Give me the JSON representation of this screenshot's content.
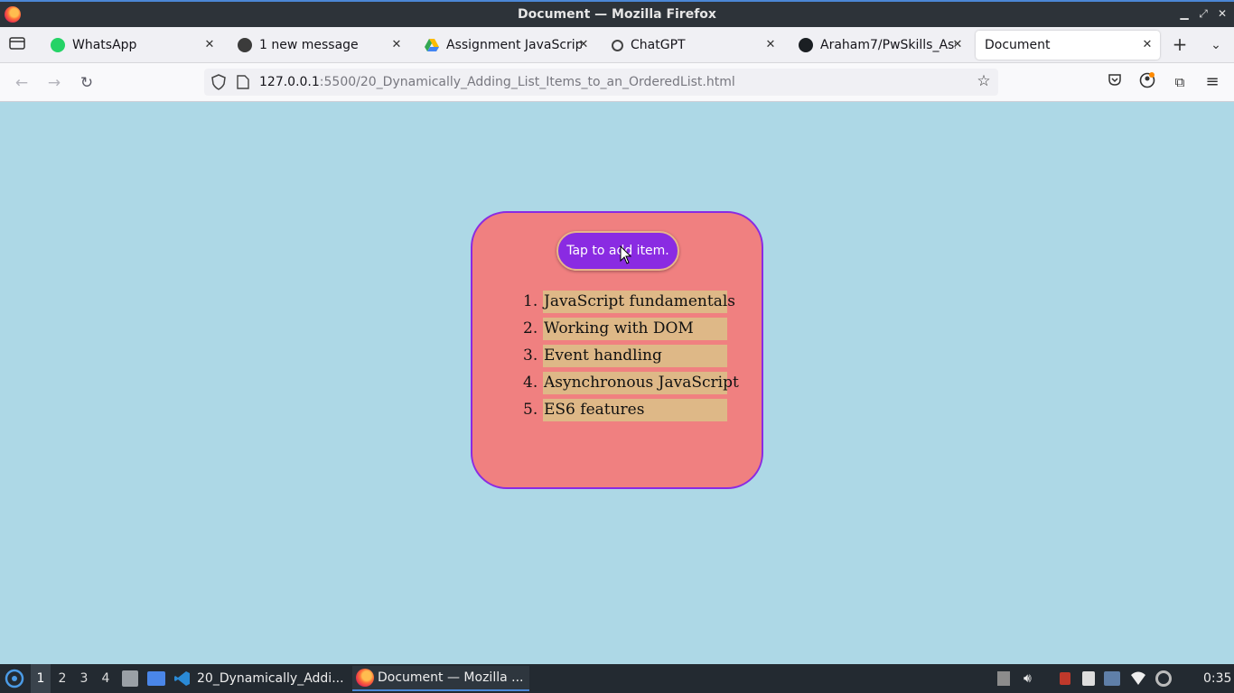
{
  "window": {
    "title": "Document — Mozilla Firefox"
  },
  "tabs": [
    {
      "label": "WhatsApp",
      "icon": "whatsapp-icon",
      "active": false
    },
    {
      "label": "1 new message",
      "icon": "wordpress-icon",
      "active": false
    },
    {
      "label": "Assignment JavaScript",
      "icon": "google-drive-icon",
      "active": false
    },
    {
      "label": "ChatGPT",
      "icon": "chatgpt-icon",
      "active": false
    },
    {
      "label": "Araham7/PwSkills_Ass",
      "icon": "github-icon",
      "active": false
    },
    {
      "label": "Document",
      "icon": "",
      "active": true
    }
  ],
  "url": {
    "host": "127.0.0.1",
    "path": ":5500/20_Dynamically_Adding_List_Items_to_an_OrderedList.html"
  },
  "page": {
    "button_label": "Tap to add item.",
    "items": [
      {
        "num": "1.",
        "text": "JavaScript fundamentals"
      },
      {
        "num": "2.",
        "text": "Working with DOM"
      },
      {
        "num": "3.",
        "text": "Event handling"
      },
      {
        "num": "4.",
        "text": "Asynchronous JavaScript"
      },
      {
        "num": "5.",
        "text": "ES6 features"
      }
    ],
    "colors": {
      "background": "#add8e6",
      "card": "#f08080",
      "border": "#8a2be2",
      "item_bg": "#deb887"
    }
  },
  "taskbar": {
    "workspaces": [
      "1",
      "2",
      "3",
      "4"
    ],
    "apps": [
      {
        "label": "20_Dynamically_Addi...",
        "icon": "vscode-icon",
        "active": false
      },
      {
        "label": "Document — Mozilla ...",
        "icon": "firefox-icon",
        "active": true
      }
    ],
    "clock": "0:35"
  }
}
